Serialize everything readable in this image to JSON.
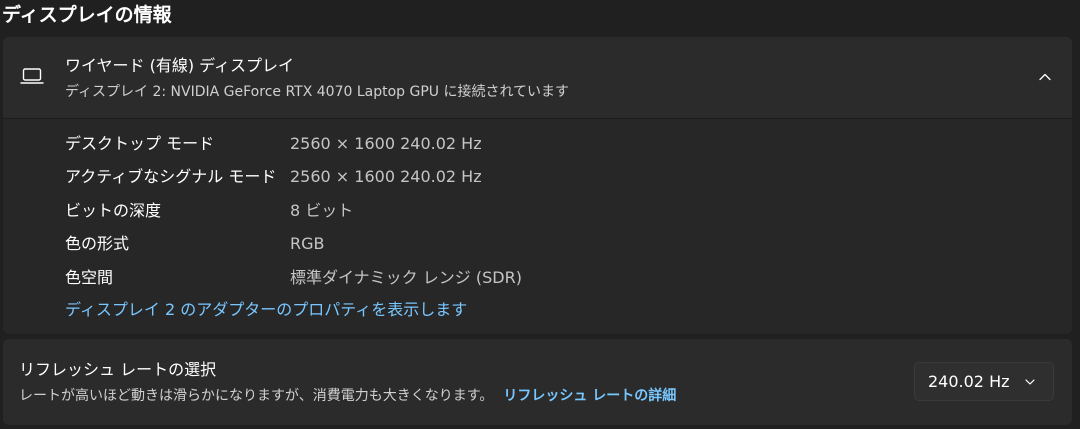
{
  "section_title": "ディスプレイの情報",
  "display": {
    "title": "ワイヤード (有線) ディスプレイ",
    "subtitle": "ディスプレイ 2: NVIDIA GeForce RTX 4070 Laptop GPU に接続されています",
    "icon": "laptop-icon",
    "expanded": true,
    "details": [
      {
        "label": "デスクトップ モード",
        "value": "2560 × 1600 240.02 Hz"
      },
      {
        "label": "アクティブなシグナル モード",
        "value": "2560 × 1600 240.02 Hz"
      },
      {
        "label": "ビットの深度",
        "value": "8 ビット"
      },
      {
        "label": "色の形式",
        "value": "RGB"
      },
      {
        "label": "色空間",
        "value": "標準ダイナミック レンジ (SDR)"
      }
    ],
    "adapter_link": "ディスプレイ 2 のアダプターのプロパティを表示します"
  },
  "refresh": {
    "title": "リフレッシュ レートの選択",
    "description": "レートが高いほど動きは滑らかになりますが、消費電力も大きくなります。",
    "link": "リフレッシュ レートの詳細",
    "selected_value": "240.02 Hz"
  },
  "colors": {
    "background": "#202020",
    "card": "#2b2b2b",
    "accent_link": "#79c7ff"
  }
}
